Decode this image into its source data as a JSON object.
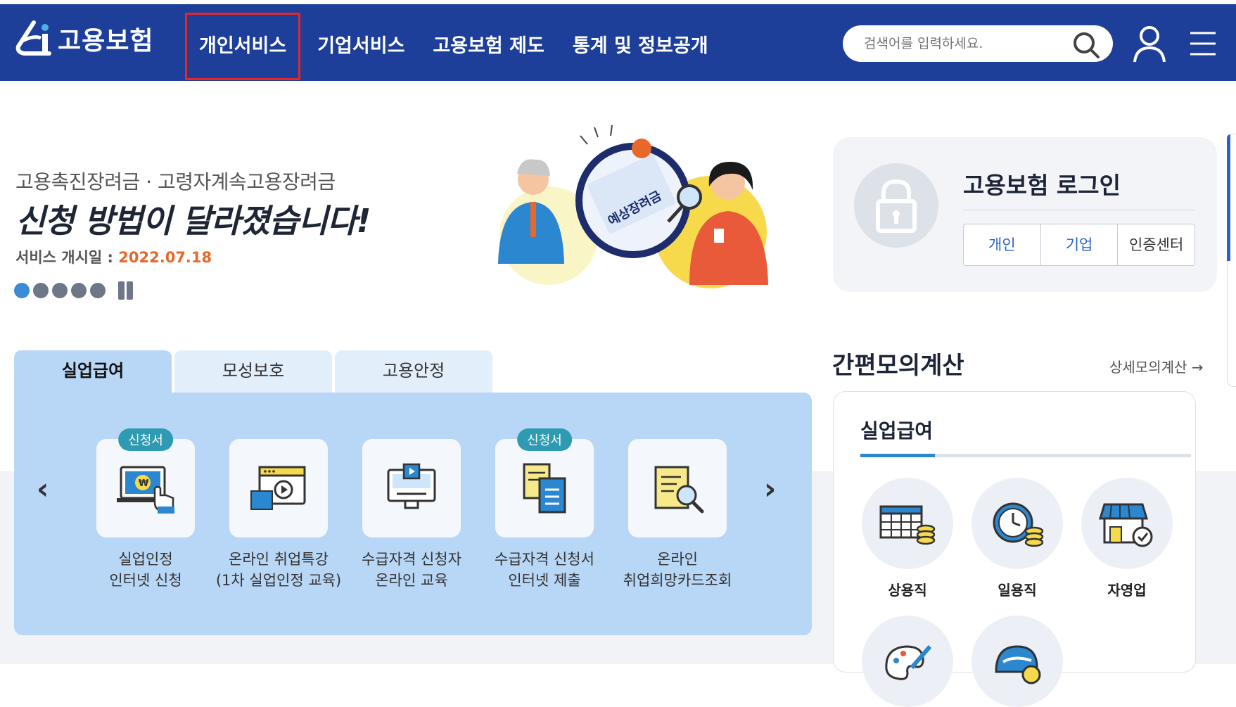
{
  "header": {
    "logo_text": "고용보험",
    "nav": [
      {
        "label": "개인서비스"
      },
      {
        "label": "기업서비스"
      },
      {
        "label": "고용보험 제도"
      },
      {
        "label": "통계 및 정보공개"
      }
    ],
    "search_placeholder": "검색어를 입력하세요."
  },
  "hero": {
    "subtitle": "고용촉진장려금 · 고령자계속고용장려금",
    "title": "신청 방법이 달라졌습니다!",
    "date_label": "서비스 개시일 : ",
    "date_value": "2022.07.18",
    "slides_total": 5,
    "slide_active": 1,
    "illustration_text": "예상장려금"
  },
  "service_tabs": [
    {
      "label": "실업급여",
      "active": true
    },
    {
      "label": "모성보호",
      "active": false
    },
    {
      "label": "고용안정",
      "active": false
    }
  ],
  "services": [
    {
      "line1": "실업인정",
      "line2": "인터넷 신청",
      "badge": "신청서"
    },
    {
      "line1": "온라인 취업특강",
      "line2": "(1차 실업인정 교육)",
      "badge": ""
    },
    {
      "line1": "수급자격 신청자",
      "line2": "온라인 교육",
      "badge": ""
    },
    {
      "line1": "수급자격 신청서",
      "line2": "인터넷 제출",
      "badge": "신청서"
    },
    {
      "line1": "온라인",
      "line2": "취업희망카드조회",
      "badge": ""
    }
  ],
  "login": {
    "title": "고용보험 로그인",
    "buttons": [
      "개인",
      "기업",
      "인증센터"
    ]
  },
  "calc": {
    "title": "간편모의계산",
    "link": "상세모의계산 →",
    "tab": "실업급여",
    "items": [
      "상용직",
      "일용직",
      "자영업"
    ]
  },
  "colors": {
    "header_bg": "#1d3f9a",
    "active_outline": "#e3262b",
    "date_accent": "#e8672a",
    "panel_bg": "#b8d6f5",
    "badge_bg": "#2f9bb2"
  }
}
